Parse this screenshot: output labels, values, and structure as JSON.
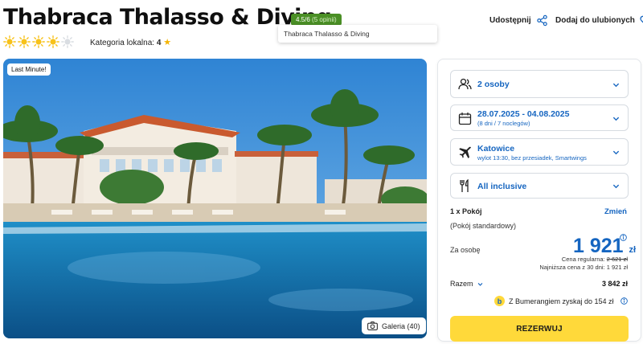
{
  "hotel": {
    "title": "Thabraca Thalasso & Diving",
    "rating": "4.5/6",
    "opinions": "(5 opinii)",
    "tooltip": "Thabraca Thalasso & Diving",
    "sun_rating": 4,
    "sun_max": 5,
    "category_label": "Kategoria lokalna:",
    "category_value": "4"
  },
  "actions": {
    "share_label": "Udostępnij",
    "favorite_label": "Dodaj do ulubionych"
  },
  "gallery": {
    "badge": "Last Minute!",
    "button_label": "Galeria (40)"
  },
  "booking": {
    "guests": "2 osoby",
    "dates": "28.07.2025 - 04.08.2025",
    "dates_sub": "(8 dni / 7 noclegów)",
    "departure": "Katowice",
    "departure_sub": "wylot 13:30, bez przesiadek, Smartwings",
    "board": "All inclusive",
    "room_count": "1 x Pokój",
    "change_label": "Zmień",
    "room_type": "(Pokój standardowy)",
    "per_person_label": "Za osobę",
    "price": "1 921",
    "currency": "zł",
    "regular_label": "Cena regularna:",
    "regular_price": "2 621 zł",
    "lowest_label": "Najniższa cena z 30 dni:",
    "lowest_price": "1 921 zł",
    "total_label": "Razem",
    "total_value": "3 842 zł",
    "bumerang_text": "Z Bumerangiem zyskaj do 154 zł",
    "reserve_label": "REZERWUJ"
  },
  "colors": {
    "accent_blue": "#1565c0",
    "rating_green": "#4a8f25",
    "button_yellow": "#ffd93a",
    "sun_yellow": "#f7c21a"
  }
}
